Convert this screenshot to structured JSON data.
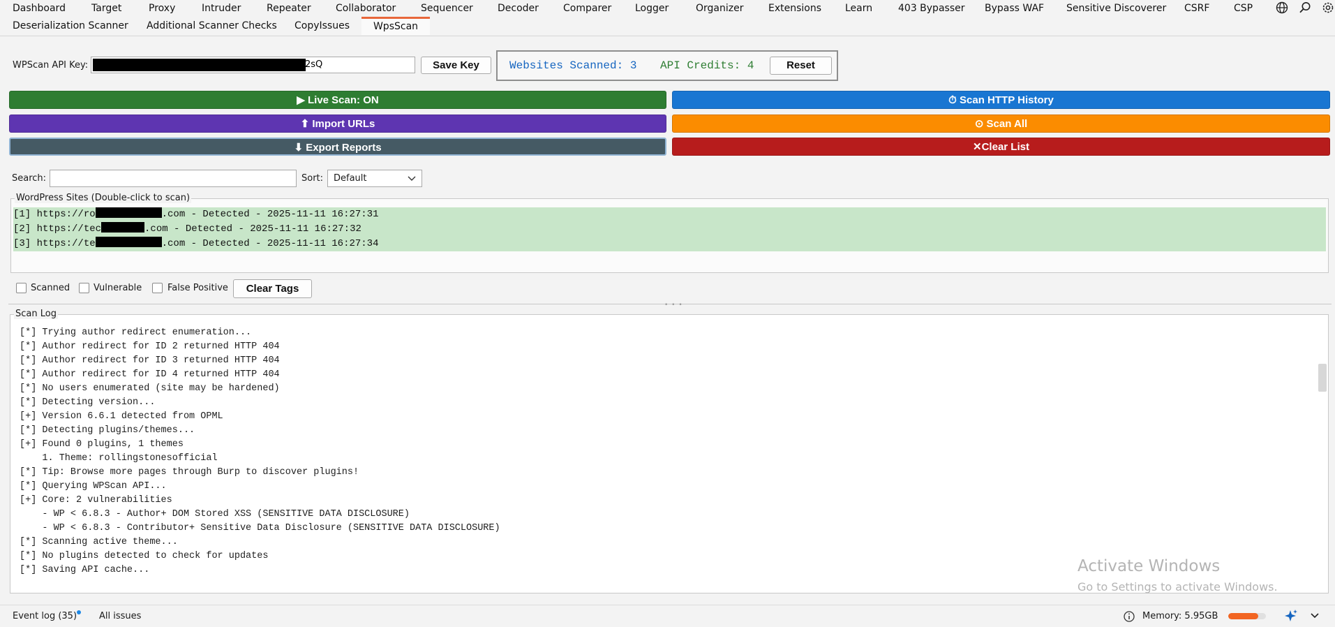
{
  "top_tabs": [
    "Dashboard",
    "Target",
    "Proxy",
    "Intruder",
    "Repeater",
    "Collaborator",
    "Sequencer",
    "Decoder",
    "Comparer",
    "Logger",
    "Organizer",
    "Extensions",
    "Learn",
    "403 Bypasser",
    "Bypass WAF",
    "Sensitive Discoverer",
    "CSRF",
    "CSP"
  ],
  "top_icons": [
    "globe-icon",
    "search-icon",
    "gear-icon"
  ],
  "sub_tabs": [
    "Deserialization Scanner",
    "Additional Scanner Checks",
    "CopyIssues",
    "WpsScan"
  ],
  "active_sub_tab": "WpsScan",
  "api": {
    "label": "WPScan API Key:",
    "value_visible_suffix": "2sQ",
    "save_label": "Save Key"
  },
  "stats": {
    "websites_scanned": "Websites Scanned: 3",
    "api_credits": "API Credits: 4",
    "reset_label": "Reset",
    "websites_color": "#1565c0",
    "credits_color": "#2e7d32"
  },
  "actions": {
    "live_scan": "▶ Live Scan: ON",
    "scan_history": "⏱ Scan HTTP History",
    "import_urls": "⬆ Import URLs",
    "scan_all": "⊙ Scan All",
    "export_reports": "⬇ Export Reports",
    "clear_list": "✕Clear List",
    "colors": {
      "live_scan": "#2e7d32",
      "scan_history": "#1976d2",
      "import_urls": "#5e35b1",
      "scan_all": "#fb8c00",
      "export_reports": "#455a64",
      "clear_list": "#b71c1c"
    }
  },
  "search": {
    "label": "Search:",
    "value": "",
    "sort_label": "Sort:",
    "sort_value": "Default"
  },
  "sites": {
    "legend": "WordPress Sites (Double-click to scan)",
    "rows": [
      {
        "prefix": "[1] https://ro",
        "suffix": ".com - Detected - 2025-11-11 16:27:31"
      },
      {
        "prefix": "[2] https://tec",
        "suffix": ".com - Detected - 2025-11-11 16:27:32"
      },
      {
        "prefix": "[3] https://te",
        "suffix": ".com - Detected - 2025-11-11 16:27:34"
      }
    ]
  },
  "tags": {
    "scanned": "Scanned",
    "vulnerable": "Vulnerable",
    "false_positive": "False Positive",
    "clear_tags": "Clear Tags"
  },
  "scan_log": {
    "legend": "Scan Log",
    "lines": [
      "[*] Trying author redirect enumeration...",
      "[*] Author redirect for ID 2 returned HTTP 404",
      "[*] Author redirect for ID 3 returned HTTP 404",
      "[*] Author redirect for ID 4 returned HTTP 404",
      "[*] No users enumerated (site may be hardened)",
      "[*] Detecting version...",
      "[+] Version 6.6.1 detected from OPML",
      "[*] Detecting plugins/themes...",
      "[+] Found 0 plugins, 1 themes",
      "    1. Theme: rollingstonesofficial",
      "[*] Tip: Browse more pages through Burp to discover plugins!",
      "[*] Querying WPScan API...",
      "[+] Core: 2 vulnerabilities",
      "    - WP < 6.8.3 - Author+ DOM Stored XSS (SENSITIVE DATA DISCLOSURE)",
      "    - WP < 6.8.3 - Contributor+ Sensitive Data Disclosure (SENSITIVE DATA DISCLOSURE)",
      "[*] Scanning active theme...",
      "[*] No plugins detected to check for updates",
      "[*] Saving API cache..."
    ]
  },
  "watermark": {
    "line1": "Activate Windows",
    "line2": "Go to Settings to activate Windows."
  },
  "statusbar": {
    "event_log": "Event log (35)",
    "all_issues": "All issues",
    "memory": "Memory: 5.95GB",
    "memory_fraction": 0.8,
    "memory_color": "#f26522"
  }
}
